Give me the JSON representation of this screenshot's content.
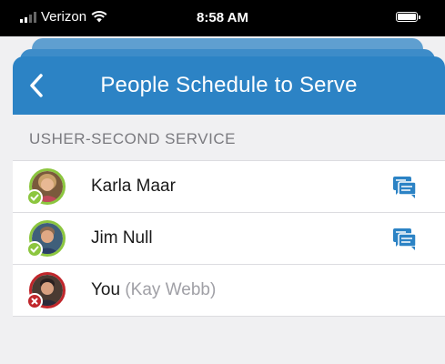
{
  "status_bar": {
    "carrier": "Verizon",
    "time": "8:58 AM"
  },
  "nav": {
    "title": "People Schedule to Serve",
    "back_icon": "chevron-left-icon"
  },
  "section": {
    "header": "USHER-SECOND SERVICE"
  },
  "people": [
    {
      "name": "Karla Maar",
      "status": "accepted",
      "has_message_icon": true
    },
    {
      "name": "Jim Null",
      "status": "accepted",
      "has_message_icon": true
    },
    {
      "name": "You",
      "sub": "(Kay Webb)",
      "status": "declined",
      "has_message_icon": false
    }
  ],
  "colors": {
    "nav_blue": "#2c83c5",
    "accepted_green": "#8cc63f",
    "declined_red": "#c0262b",
    "message_icon_blue": "#2c83c5"
  }
}
